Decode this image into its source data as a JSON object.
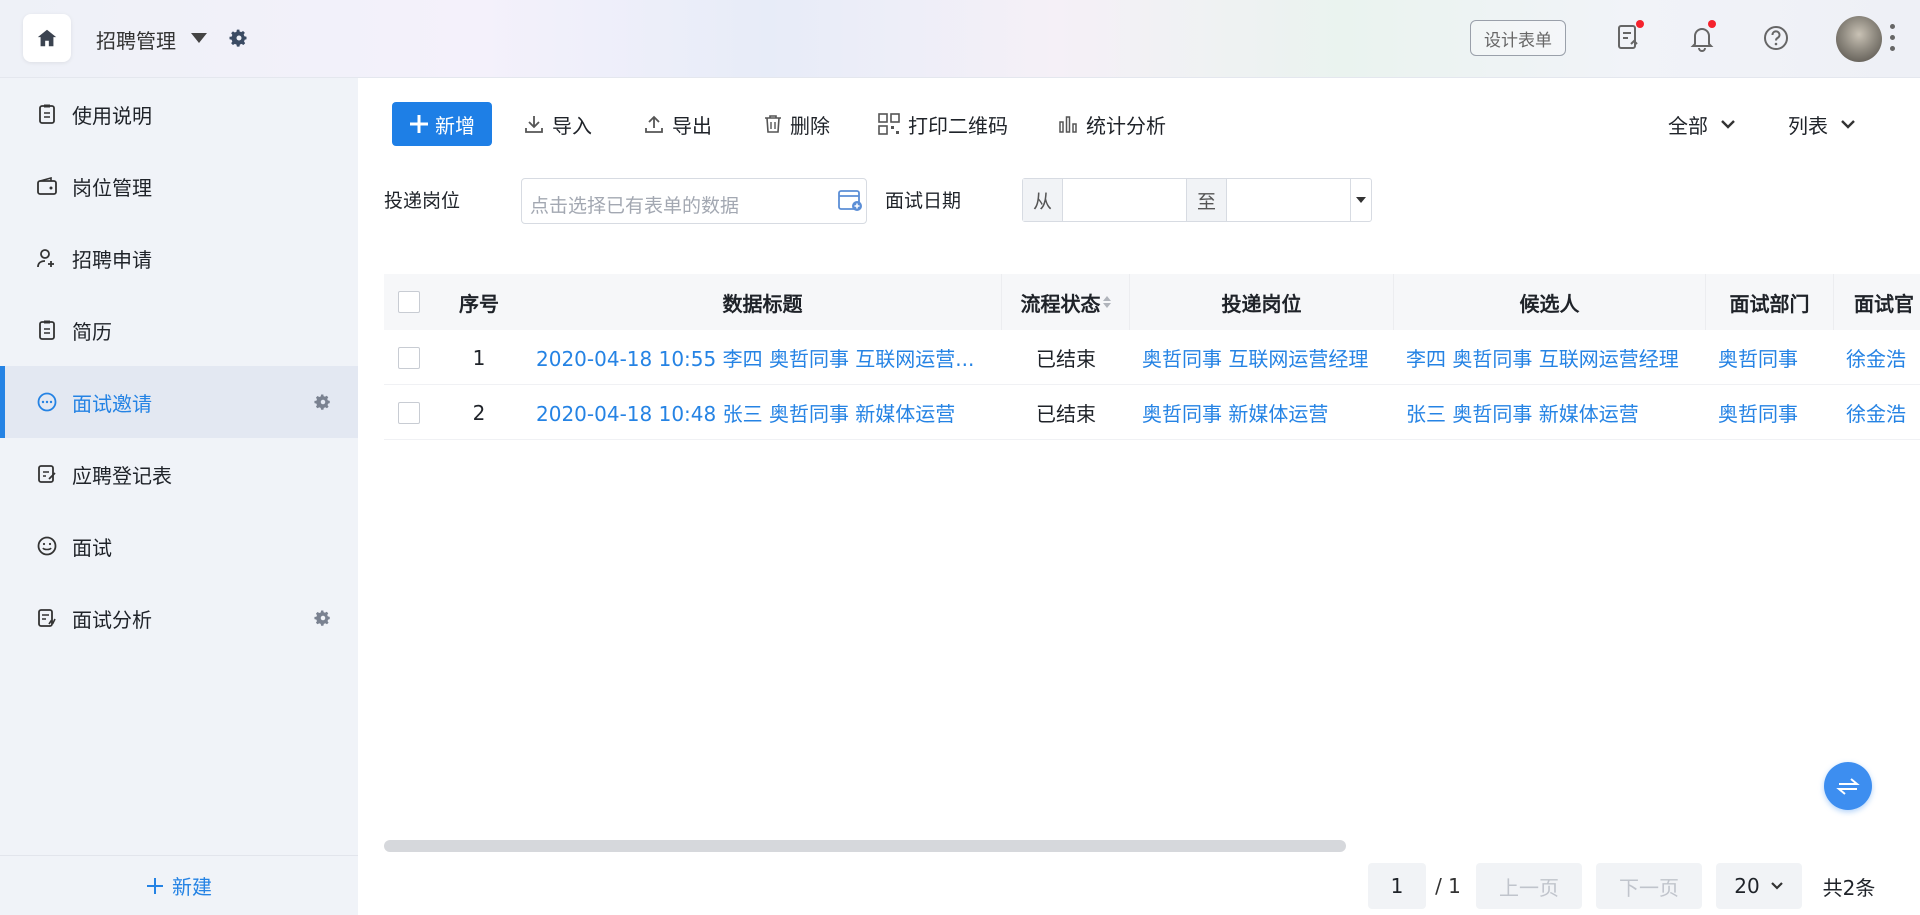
{
  "header": {
    "app_title": "招聘管理",
    "design_form_label": "设计表单",
    "icons": [
      "home-icon",
      "chevron-down-icon",
      "gear-icon",
      "form-icon",
      "bell-icon",
      "help-icon",
      "avatar",
      "more-icon"
    ]
  },
  "sidebar": {
    "items": [
      {
        "label": "使用说明",
        "icon": "clipboard-icon"
      },
      {
        "label": "岗位管理",
        "icon": "wallet-icon"
      },
      {
        "label": "招聘申请",
        "icon": "user-add-icon"
      },
      {
        "label": "简历",
        "icon": "clipboard-icon"
      },
      {
        "label": "面试邀请",
        "icon": "chat-icon",
        "active": true
      },
      {
        "label": "应聘登记表",
        "icon": "edit-icon"
      },
      {
        "label": "面试",
        "icon": "smile-icon"
      },
      {
        "label": "面试分析",
        "icon": "report-icon"
      }
    ],
    "footer_label": "新建"
  },
  "toolbar": {
    "new_label": "新增",
    "import_label": "导入",
    "export_label": "导出",
    "delete_label": "删除",
    "print_qr_label": "打印二维码",
    "stats_label": "统计分析",
    "filter_scope": "全部",
    "view_mode": "列表"
  },
  "filters": {
    "position_label": "投递岗位",
    "position_placeholder": "点击选择已有表单的数据",
    "date_label": "面试日期",
    "from_label": "从",
    "to_label": "至"
  },
  "table": {
    "columns": [
      "序号",
      "数据标题",
      "流程状态",
      "投递岗位",
      "候选人",
      "面试部门",
      "面试官"
    ],
    "rows": [
      {
        "index": "1",
        "title": "2020-04-18 10:55 李四 奥哲同事 互联网运营...",
        "status": "已结束",
        "position": "奥哲同事 互联网运营经理",
        "candidate": "李四 奥哲同事 互联网运营经理",
        "department": "奥哲同事",
        "interviewer": "徐金浩"
      },
      {
        "index": "2",
        "title": "2020-04-18 10:48 张三 奥哲同事 新媒体运营",
        "status": "已结束",
        "position": "奥哲同事 新媒体运营",
        "candidate": "张三 奥哲同事 新媒体运营",
        "department": "奥哲同事",
        "interviewer": "徐金浩"
      }
    ]
  },
  "pagination": {
    "current_page": "1",
    "total_pages": "/ 1",
    "prev_label": "上一页",
    "next_label": "下一页",
    "page_size": "20",
    "total_label": "共2条"
  },
  "colors": {
    "accent": "#2583e4",
    "primary_button": "#1e7fe6",
    "sidebar_bg": "#f0f3f8",
    "active_item_bg": "#e3e8f2",
    "notification_dot": "#f5222d"
  }
}
